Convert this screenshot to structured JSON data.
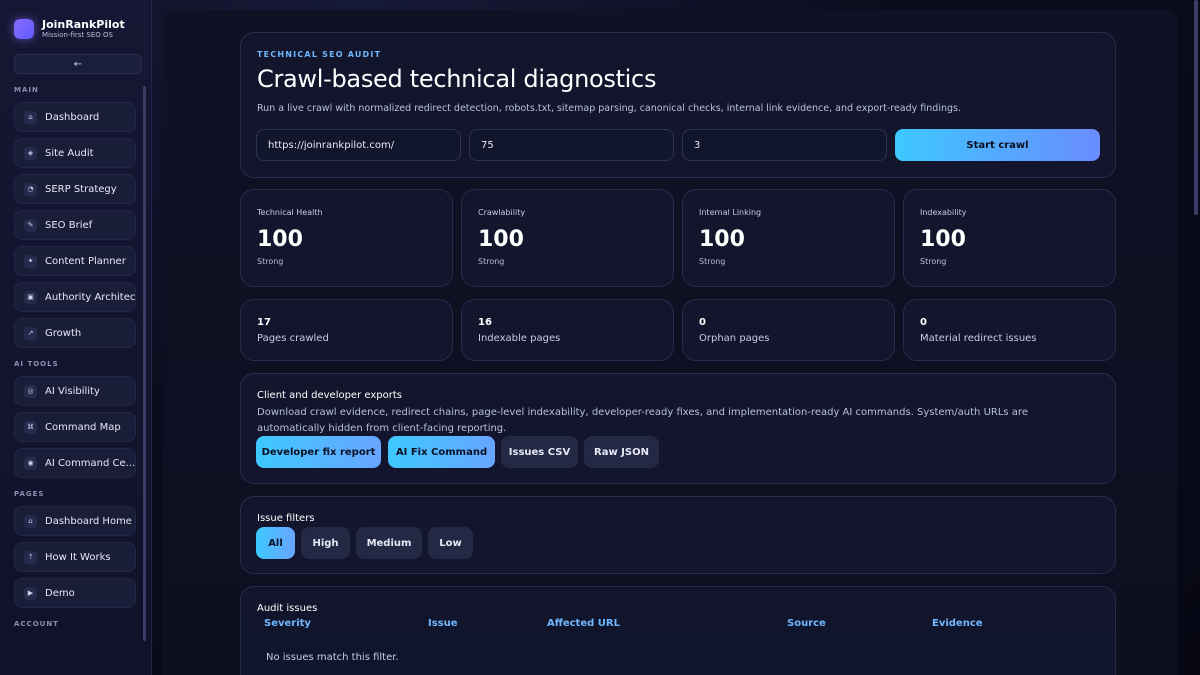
{
  "brand": {
    "name": "JoinRankPilot",
    "tagline": "Mission-first SEO OS"
  },
  "sidebar": {
    "collapse_label": "←",
    "sections": [
      {
        "label": "MAIN",
        "items": [
          {
            "label": "Dashboard",
            "icon": "⌂"
          },
          {
            "label": "Site Audit",
            "icon": "◈"
          },
          {
            "label": "SERP Strategy",
            "icon": "◔"
          },
          {
            "label": "SEO Brief",
            "icon": "✎"
          },
          {
            "label": "Content Planner",
            "icon": "✦"
          },
          {
            "label": "Authority Architect",
            "icon": "▣"
          },
          {
            "label": "Growth",
            "icon": "↗"
          }
        ]
      },
      {
        "label": "AI TOOLS",
        "items": [
          {
            "label": "AI Visibility",
            "icon": "◎"
          },
          {
            "label": "Command Map",
            "icon": "⌘"
          },
          {
            "label": "AI Command Ce...",
            "icon": "◉"
          }
        ]
      },
      {
        "label": "PAGES",
        "items": [
          {
            "label": "Dashboard Home",
            "icon": "⌂"
          },
          {
            "label": "How It Works",
            "icon": "?"
          },
          {
            "label": "Demo",
            "icon": "▶"
          }
        ]
      },
      {
        "label": "ACCOUNT",
        "items": []
      }
    ]
  },
  "hero": {
    "eyebrow": "TECHNICAL SEO AUDIT",
    "title": "Crawl-based technical diagnostics",
    "subtitle": "Run a live crawl with normalized redirect detection, robots.txt, sitemap parsing, canonical checks, internal link evidence, and export-ready findings.",
    "url_value": "https://joinrankpilot.com/",
    "pages_value": "75",
    "depth_value": "3",
    "start_label": "Start crawl"
  },
  "scores": [
    {
      "label": "Technical Health",
      "value": "100",
      "status": "Strong"
    },
    {
      "label": "Crawlability",
      "value": "100",
      "status": "Strong"
    },
    {
      "label": "Internal Linking",
      "value": "100",
      "status": "Strong"
    },
    {
      "label": "Indexability",
      "value": "100",
      "status": "Strong"
    }
  ],
  "stats": [
    {
      "value": "17",
      "label": "Pages crawled"
    },
    {
      "value": "16",
      "label": "Indexable pages"
    },
    {
      "value": "0",
      "label": "Orphan pages"
    },
    {
      "value": "0",
      "label": "Material redirect issues"
    }
  ],
  "exports": {
    "title": "Client and developer exports",
    "description": "Download crawl evidence, redirect chains, page-level indexability, developer-ready fixes, and implementation-ready AI commands. System/auth URLs are automatically hidden from client-facing reporting.",
    "buttons": [
      "Developer fix report",
      "AI Fix Command",
      "Issues CSV",
      "Raw JSON"
    ]
  },
  "filters": {
    "title": "Issue filters",
    "options": [
      "All",
      "High",
      "Medium",
      "Low"
    ],
    "selected": "All"
  },
  "issues": {
    "title": "Audit issues",
    "columns": [
      "Severity",
      "Issue",
      "Affected URL",
      "Source",
      "Evidence"
    ],
    "empty_message": "No issues match this filter."
  },
  "colors": {
    "accent": "#3ec8ff",
    "accent2": "#6a8cff",
    "heading_blue": "#6fb8ff"
  }
}
